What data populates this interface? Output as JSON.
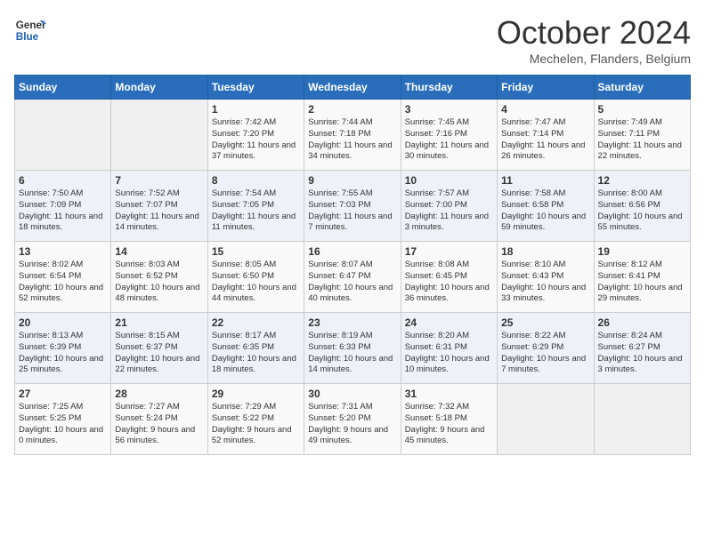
{
  "logo": {
    "line1": "General",
    "line2": "Blue"
  },
  "title": "October 2024",
  "location": "Mechelen, Flanders, Belgium",
  "days_of_week": [
    "Sunday",
    "Monday",
    "Tuesday",
    "Wednesday",
    "Thursday",
    "Friday",
    "Saturday"
  ],
  "weeks": [
    [
      {
        "day": "",
        "sunrise": "",
        "sunset": "",
        "daylight": ""
      },
      {
        "day": "",
        "sunrise": "",
        "sunset": "",
        "daylight": ""
      },
      {
        "day": "1",
        "sunrise": "Sunrise: 7:42 AM",
        "sunset": "Sunset: 7:20 PM",
        "daylight": "Daylight: 11 hours and 37 minutes."
      },
      {
        "day": "2",
        "sunrise": "Sunrise: 7:44 AM",
        "sunset": "Sunset: 7:18 PM",
        "daylight": "Daylight: 11 hours and 34 minutes."
      },
      {
        "day": "3",
        "sunrise": "Sunrise: 7:45 AM",
        "sunset": "Sunset: 7:16 PM",
        "daylight": "Daylight: 11 hours and 30 minutes."
      },
      {
        "day": "4",
        "sunrise": "Sunrise: 7:47 AM",
        "sunset": "Sunset: 7:14 PM",
        "daylight": "Daylight: 11 hours and 26 minutes."
      },
      {
        "day": "5",
        "sunrise": "Sunrise: 7:49 AM",
        "sunset": "Sunset: 7:11 PM",
        "daylight": "Daylight: 11 hours and 22 minutes."
      }
    ],
    [
      {
        "day": "6",
        "sunrise": "Sunrise: 7:50 AM",
        "sunset": "Sunset: 7:09 PM",
        "daylight": "Daylight: 11 hours and 18 minutes."
      },
      {
        "day": "7",
        "sunrise": "Sunrise: 7:52 AM",
        "sunset": "Sunset: 7:07 PM",
        "daylight": "Daylight: 11 hours and 14 minutes."
      },
      {
        "day": "8",
        "sunrise": "Sunrise: 7:54 AM",
        "sunset": "Sunset: 7:05 PM",
        "daylight": "Daylight: 11 hours and 11 minutes."
      },
      {
        "day": "9",
        "sunrise": "Sunrise: 7:55 AM",
        "sunset": "Sunset: 7:03 PM",
        "daylight": "Daylight: 11 hours and 7 minutes."
      },
      {
        "day": "10",
        "sunrise": "Sunrise: 7:57 AM",
        "sunset": "Sunset: 7:00 PM",
        "daylight": "Daylight: 11 hours and 3 minutes."
      },
      {
        "day": "11",
        "sunrise": "Sunrise: 7:58 AM",
        "sunset": "Sunset: 6:58 PM",
        "daylight": "Daylight: 10 hours and 59 minutes."
      },
      {
        "day": "12",
        "sunrise": "Sunrise: 8:00 AM",
        "sunset": "Sunset: 6:56 PM",
        "daylight": "Daylight: 10 hours and 55 minutes."
      }
    ],
    [
      {
        "day": "13",
        "sunrise": "Sunrise: 8:02 AM",
        "sunset": "Sunset: 6:54 PM",
        "daylight": "Daylight: 10 hours and 52 minutes."
      },
      {
        "day": "14",
        "sunrise": "Sunrise: 8:03 AM",
        "sunset": "Sunset: 6:52 PM",
        "daylight": "Daylight: 10 hours and 48 minutes."
      },
      {
        "day": "15",
        "sunrise": "Sunrise: 8:05 AM",
        "sunset": "Sunset: 6:50 PM",
        "daylight": "Daylight: 10 hours and 44 minutes."
      },
      {
        "day": "16",
        "sunrise": "Sunrise: 8:07 AM",
        "sunset": "Sunset: 6:47 PM",
        "daylight": "Daylight: 10 hours and 40 minutes."
      },
      {
        "day": "17",
        "sunrise": "Sunrise: 8:08 AM",
        "sunset": "Sunset: 6:45 PM",
        "daylight": "Daylight: 10 hours and 36 minutes."
      },
      {
        "day": "18",
        "sunrise": "Sunrise: 8:10 AM",
        "sunset": "Sunset: 6:43 PM",
        "daylight": "Daylight: 10 hours and 33 minutes."
      },
      {
        "day": "19",
        "sunrise": "Sunrise: 8:12 AM",
        "sunset": "Sunset: 6:41 PM",
        "daylight": "Daylight: 10 hours and 29 minutes."
      }
    ],
    [
      {
        "day": "20",
        "sunrise": "Sunrise: 8:13 AM",
        "sunset": "Sunset: 6:39 PM",
        "daylight": "Daylight: 10 hours and 25 minutes."
      },
      {
        "day": "21",
        "sunrise": "Sunrise: 8:15 AM",
        "sunset": "Sunset: 6:37 PM",
        "daylight": "Daylight: 10 hours and 22 minutes."
      },
      {
        "day": "22",
        "sunrise": "Sunrise: 8:17 AM",
        "sunset": "Sunset: 6:35 PM",
        "daylight": "Daylight: 10 hours and 18 minutes."
      },
      {
        "day": "23",
        "sunrise": "Sunrise: 8:19 AM",
        "sunset": "Sunset: 6:33 PM",
        "daylight": "Daylight: 10 hours and 14 minutes."
      },
      {
        "day": "24",
        "sunrise": "Sunrise: 8:20 AM",
        "sunset": "Sunset: 6:31 PM",
        "daylight": "Daylight: 10 hours and 10 minutes."
      },
      {
        "day": "25",
        "sunrise": "Sunrise: 8:22 AM",
        "sunset": "Sunset: 6:29 PM",
        "daylight": "Daylight: 10 hours and 7 minutes."
      },
      {
        "day": "26",
        "sunrise": "Sunrise: 8:24 AM",
        "sunset": "Sunset: 6:27 PM",
        "daylight": "Daylight: 10 hours and 3 minutes."
      }
    ],
    [
      {
        "day": "27",
        "sunrise": "Sunrise: 7:25 AM",
        "sunset": "Sunset: 5:25 PM",
        "daylight": "Daylight: 10 hours and 0 minutes."
      },
      {
        "day": "28",
        "sunrise": "Sunrise: 7:27 AM",
        "sunset": "Sunset: 5:24 PM",
        "daylight": "Daylight: 9 hours and 56 minutes."
      },
      {
        "day": "29",
        "sunrise": "Sunrise: 7:29 AM",
        "sunset": "Sunset: 5:22 PM",
        "daylight": "Daylight: 9 hours and 52 minutes."
      },
      {
        "day": "30",
        "sunrise": "Sunrise: 7:31 AM",
        "sunset": "Sunset: 5:20 PM",
        "daylight": "Daylight: 9 hours and 49 minutes."
      },
      {
        "day": "31",
        "sunrise": "Sunrise: 7:32 AM",
        "sunset": "Sunset: 5:18 PM",
        "daylight": "Daylight: 9 hours and 45 minutes."
      },
      {
        "day": "",
        "sunrise": "",
        "sunset": "",
        "daylight": ""
      },
      {
        "day": "",
        "sunrise": "",
        "sunset": "",
        "daylight": ""
      }
    ]
  ]
}
